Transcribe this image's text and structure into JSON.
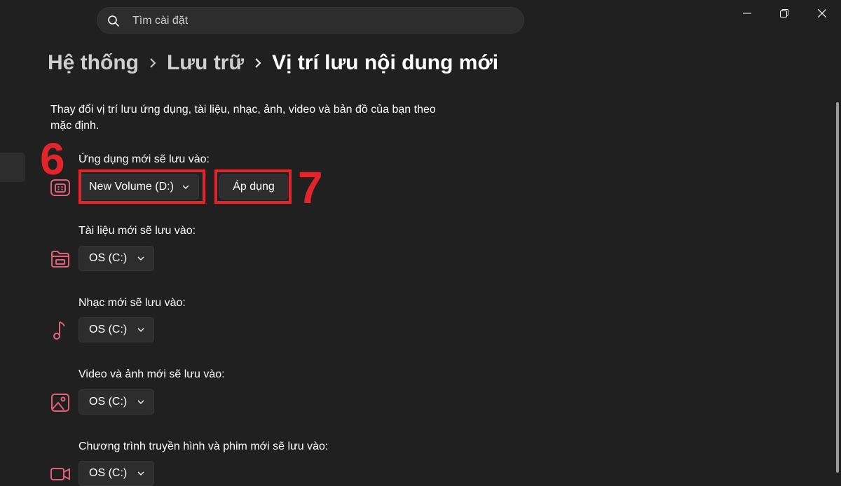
{
  "search": {
    "placeholder": "Tìm cài đặt"
  },
  "window_controls": {
    "minimize": "minimize-icon",
    "restore": "restore-icon",
    "close": "close-icon"
  },
  "breadcrumb": {
    "items": [
      "Hệ thống",
      "Lưu trữ",
      "Vị trí lưu nội dung mới"
    ]
  },
  "description": "Thay đổi vị trí lưu ứng dụng, tài liệu, nhạc, ảnh, video và bản đồ của bạn theo mặc định.",
  "sections": [
    {
      "label": "Ứng dụng mới sẽ lưu vào:",
      "icon": "app-icon",
      "value": "New Volume (D:)",
      "apply_label": "Áp dụng"
    },
    {
      "label": "Tài liệu mới sẽ lưu vào:",
      "icon": "folder-icon",
      "value": "OS (C:)"
    },
    {
      "label": "Nhạc mới sẽ lưu vào:",
      "icon": "music-icon",
      "value": "OS (C:)"
    },
    {
      "label": "Video và ảnh mới sẽ lưu vào:",
      "icon": "image-icon",
      "value": "OS (C:)"
    },
    {
      "label": "Chương trình truyền hình và phim mới sẽ lưu vào:",
      "icon": "video-camera-icon",
      "value": "OS (C:)"
    }
  ],
  "annotations": {
    "step_dropdown": "6",
    "step_apply": "7"
  },
  "colors": {
    "background": "#202020",
    "control": "#2d2d2d",
    "accent_icon": "#e0607e",
    "highlight": "#e1252b"
  }
}
